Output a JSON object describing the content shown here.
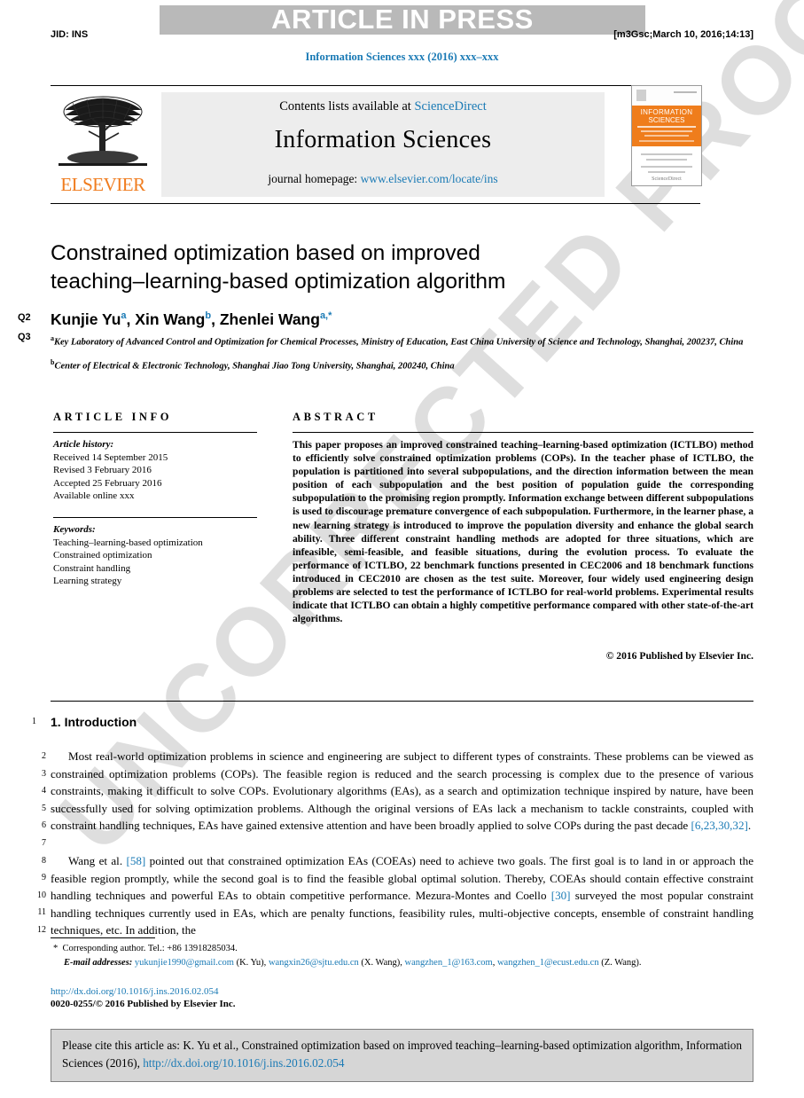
{
  "header": {
    "banner_text": "ARTICLE IN PRESS",
    "jid": "JID: INS",
    "stamp": "[m3Gsc;March 10, 2016;14:13]",
    "running_head": "Information Sciences xxx (2016) xxx–xxx"
  },
  "masthead": {
    "contents_prefix": "Contents lists available at ",
    "sciencedirect": "ScienceDirect",
    "journal_title": "Information Sciences",
    "homepage_prefix": "journal homepage: ",
    "homepage_url": "www.elsevier.com/locate/ins",
    "publisher": "ELSEVIER",
    "cover": {
      "line1": "INFORMATION",
      "line2": "SCIENCES",
      "footer": "ScienceDirect"
    }
  },
  "article": {
    "title_line1": "Constrained optimization based on improved",
    "title_line2": "teaching–learning-based optimization algorithm",
    "query_markers": [
      "Q2",
      "Q3"
    ],
    "authors": [
      {
        "name": "Kunjie Yu",
        "sup": "a"
      },
      {
        "name": "Xin Wang",
        "sup": "b"
      },
      {
        "name": "Zhenlei Wang",
        "sup": "a,*"
      }
    ],
    "affiliations": [
      {
        "mark": "a",
        "text": "Key Laboratory of Advanced Control and Optimization for Chemical Processes, Ministry of Education, East China University of Science and Technology, Shanghai, 200237, China"
      },
      {
        "mark": "b",
        "text": "Center of Electrical & Electronic Technology, Shanghai Jiao Tong University, Shanghai, 200240, China"
      }
    ]
  },
  "info": {
    "heading": "ARTICLE INFO",
    "history_label": "Article history:",
    "history": [
      "Received 14 September 2015",
      "Revised 3 February 2016",
      "Accepted 25 February 2016",
      "Available online xxx"
    ],
    "keywords_label": "Keywords:",
    "keywords": [
      "Teaching–learning-based optimization",
      "Constrained optimization",
      "Constraint handling",
      "Learning strategy"
    ]
  },
  "abstract": {
    "heading": "ABSTRACT",
    "text": "This paper proposes an improved constrained teaching–learning-based optimization (ICTLBO) method to efficiently solve constrained optimization problems (COPs). In the teacher phase of ICTLBO, the population is partitioned into several subpopulations, and the direction information between the mean position of each subpopulation and the best position of population guide the corresponding subpopulation to the promising region promptly. Information exchange between different subpopulations is used to discourage premature convergence of each subpopulation. Furthermore, in the learner phase, a new learning strategy is introduced to improve the population diversity and enhance the global search ability. Three different constraint handling methods are adopted for three situations, which are infeasible, semi-feasible, and feasible situations, during the evolution process. To evaluate the performance of ICTLBO, 22 benchmark functions presented in CEC2006 and 18 benchmark functions introduced in CEC2010 are chosen as the test suite. Moreover, four widely used engineering design problems are selected to test the performance of ICTLBO for real-world problems. Experimental results indicate that ICTLBO can obtain a highly competitive performance compared with other state-of-the-art algorithms.",
    "copyright": "© 2016 Published by Elsevier Inc."
  },
  "body": {
    "section_number": "1.",
    "section_title": "Introduction",
    "line_numbers": [
      "1",
      "2",
      "3",
      "4",
      "5",
      "6",
      "7",
      "8",
      "9",
      "10",
      "11",
      "12"
    ],
    "paragraph1": "Most real-world optimization problems in science and engineering are subject to different types of constraints. These problems can be viewed as constrained optimization problems (COPs). The feasible region is reduced and the search processing is complex due to the presence of various constraints, making it difficult to solve COPs. Evolutionary algorithms (EAs), as a search and optimization technique inspired by nature, have been successfully used for solving optimization problems. Although the original versions of EAs lack a mechanism to tackle constraints, coupled with constraint handling techniques, EAs have gained extensive attention and have been broadly applied to solve COPs during the past decade",
    "ref1": "[6,23,30,32]",
    "paragraph2_a": "Wang et al.",
    "ref2": "[58]",
    "paragraph2_b": "pointed out that constrained optimization EAs (COEAs) need to achieve two goals. The first goal is to land in or approach the feasible region promptly, while the second goal is to find the feasible global optimal solution. Thereby, COEAs should contain effective constraint handling techniques and powerful EAs to obtain competitive performance. Mezura-Montes and Coello",
    "ref3": "[30]",
    "paragraph2_c": "surveyed the most popular constraint handling techniques currently used in EAs, which are penalty functions, feasibility rules, multi-objective concepts, ensemble of constraint handling techniques, etc. In addition, the"
  },
  "footnotes": {
    "corresponding": "Corresponding author. Tel.: +86 13918285034.",
    "email_label": "E-mail addresses:",
    "emails": [
      {
        "address": "yukunjie1990@gmail.com",
        "person": "(K. Yu),"
      },
      {
        "address": "wangxin26@sjtu.edu.cn",
        "person": "(X. Wang),"
      },
      {
        "address": "wangzhen_1@163.com",
        "person": ","
      },
      {
        "address": "wangzhen_1@ecust.edu.cn",
        "person": "(Z. Wang)."
      }
    ],
    "doi": "http://dx.doi.org/10.1016/j.ins.2016.02.054",
    "issn": "0020-0255/© 2016 Published by Elsevier Inc."
  },
  "cite_box": {
    "text_a": "Please cite this article as: K. Yu et al., Constrained optimization based on improved teaching–learning-based optimization algorithm, Information Sciences (2016), ",
    "link": "http://dx.doi.org/10.1016/j.ins.2016.02.054"
  },
  "watermark": {
    "text": "UNCORRECTED PROOF"
  },
  "colors": {
    "link": "#1a7ab5",
    "banner": "#b9b9b9",
    "elsevier_orange": "#f07c1e",
    "cite_box_bg": "#d6d6d6"
  }
}
